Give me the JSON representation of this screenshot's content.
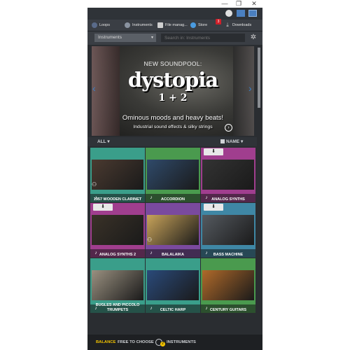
{
  "tabs": [
    {
      "label": "Loops",
      "color": "#5a6b8a"
    },
    {
      "label": "Instruments",
      "color": "#8a93a0"
    },
    {
      "label": "File manag...",
      "color": "#cfcfcf"
    },
    {
      "label": "Store",
      "color": "#4a9be0"
    },
    {
      "label": "Downloads",
      "color": "#cfcfcf"
    }
  ],
  "store_badge": "3",
  "filter_select": {
    "value": "Instruments"
  },
  "search": {
    "placeholder": "Search in: Instruments"
  },
  "banner": {
    "kicker": "NEW SOUNDPOOL:",
    "logo": "dystopia",
    "logo_suffix": "1 + 2",
    "tagline": "Ominous moods and heavy beats!",
    "subline": "Industrial sound effects & silky strings"
  },
  "filter_row": {
    "all_label": "ALL",
    "sort_label": "NAME"
  },
  "instruments": [
    {
      "name": "1957 WOODEN CLARINET",
      "color": "#3a9e8a",
      "shot": "#4a3a30"
    },
    {
      "name": "ACCORDION",
      "color": "#4a9a4e",
      "shot": "#2f4a6a"
    },
    {
      "name": "ANALOG SYNTHS",
      "color": "#a03e8e",
      "shot": "#333"
    },
    {
      "name": "ANALOG SYNTHS 2",
      "color": "#a03e8e",
      "shot": "#3a3228"
    },
    {
      "name": "BALALAIKA",
      "color": "#7a4a9e",
      "shot": "#c8a35a"
    },
    {
      "name": "BASS MACHINE",
      "color": "#3f87a5",
      "shot": "#555a60"
    },
    {
      "name": "BUGLES AND PICCOLO TRUMPETS",
      "color": "#3a9e8a",
      "shot": "#9a9080"
    },
    {
      "name": "CELTIC HARP",
      "color": "#3a9e8a",
      "shot": "#2a4a7a"
    },
    {
      "name": "CENTURY GUITARS",
      "color": "#4a9a4e",
      "shot": "#b06a2a"
    }
  ],
  "bottom": {
    "balance": "BALANCE",
    "free": "FREE TO CHOOSE",
    "instruments": "INSTRUMENTS",
    "count": "2"
  }
}
